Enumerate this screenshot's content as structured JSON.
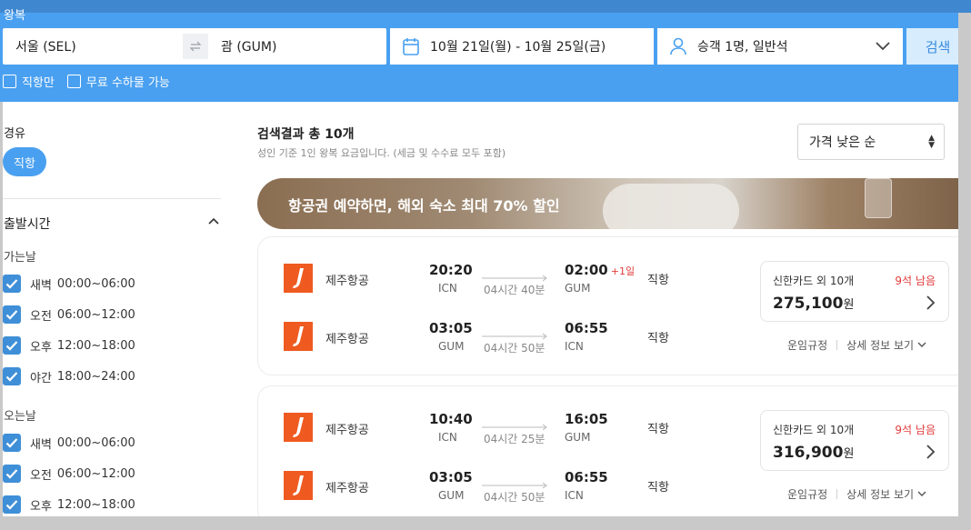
{
  "search": {
    "trip_type": "왕복",
    "from": "서울 (SEL)",
    "to": "괌 (GUM)",
    "dates": "10월 21일(월)  - 10월 25일(금)",
    "passengers": "승객 1명, 일반석",
    "search_label": "검색",
    "filter_direct": "직항만",
    "filter_baggage": "무료 수하물 가능"
  },
  "sidebar": {
    "stops_title": "경유",
    "stops_chip": "직항",
    "departure_title": "출발시간",
    "outbound_label": "가는날",
    "return_label": "오는날",
    "outbound_slots": [
      {
        "name": "새벽",
        "range": "00:00~06:00"
      },
      {
        "name": "오전",
        "range": "06:00~12:00"
      },
      {
        "name": "오후",
        "range": "12:00~18:00"
      },
      {
        "name": "야간",
        "range": "18:00~24:00"
      }
    ],
    "return_slots": [
      {
        "name": "새벽",
        "range": "00:00~06:00"
      },
      {
        "name": "오전",
        "range": "06:00~12:00"
      },
      {
        "name": "오후",
        "range": "12:00~18:00"
      }
    ]
  },
  "results": {
    "title": "검색결과 총 10개",
    "note": "성인 기준 1인 왕복 요금입니다. (세금 및 수수료 모두 포함)",
    "sort_label": "가격 낮은 순",
    "banner": "항공권 예약하면, 해외 숙소 최대 70% 할인",
    "fare_rules": "운임규정",
    "details": "상세 정보 보기",
    "flights": [
      {
        "out": {
          "airline": "제주항공",
          "dep_time": "20:20",
          "dep_airport": "ICN",
          "duration": "04시간 40분",
          "arr_time": "02:00",
          "plus_day": "+1일",
          "arr_airport": "GUM",
          "stops": "직항"
        },
        "ret": {
          "airline": "제주항공",
          "dep_time": "03:05",
          "dep_airport": "GUM",
          "duration": "04시간 50분",
          "arr_time": "06:55",
          "plus_day": "",
          "arr_airport": "ICN",
          "stops": "직항"
        },
        "card": "신한카드 외 10개",
        "seats": "9석 남음",
        "price": "275,100",
        "currency": "원"
      },
      {
        "out": {
          "airline": "제주항공",
          "dep_time": "10:40",
          "dep_airport": "ICN",
          "duration": "04시간 25분",
          "arr_time": "16:05",
          "plus_day": "",
          "arr_airport": "GUM",
          "stops": "직항"
        },
        "ret": {
          "airline": "제주항공",
          "dep_time": "03:05",
          "dep_airport": "GUM",
          "duration": "04시간 50분",
          "arr_time": "06:55",
          "plus_day": "",
          "arr_airport": "ICN",
          "stops": "직항"
        },
        "card": "신한카드 외 10개",
        "seats": "9석 남음",
        "price": "316,900",
        "currency": "원"
      }
    ]
  }
}
